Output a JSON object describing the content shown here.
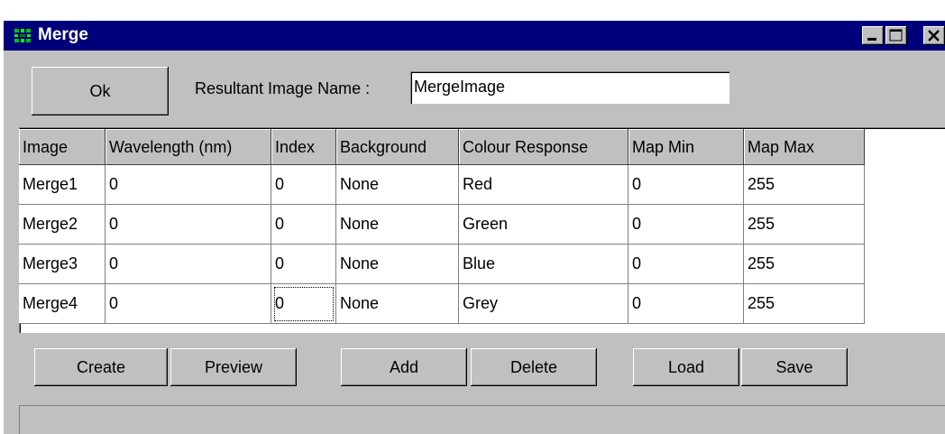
{
  "window": {
    "title": "Merge"
  },
  "toolbar": {
    "ok_label": "Ok"
  },
  "name_field": {
    "label": "Resultant Image Name :",
    "value": "MergeImage"
  },
  "table": {
    "columns": [
      "Image",
      "Wavelength (nm)",
      "Index",
      "Background",
      "Colour Response",
      "Map Min",
      "Map Max"
    ],
    "rows": [
      [
        "Merge1",
        "0",
        "0",
        "None",
        "Red",
        "0",
        "255"
      ],
      [
        "Merge2",
        "0",
        "0",
        "None",
        "Green",
        "0",
        "255"
      ],
      [
        "Merge3",
        "0",
        "0",
        "None",
        "Blue",
        "0",
        "255"
      ],
      [
        "Merge4",
        "0",
        "0",
        "None",
        "Grey",
        "0",
        "255"
      ]
    ]
  },
  "buttons": {
    "create": "Create",
    "preview": "Preview",
    "add": "Add",
    "delete": "Delete",
    "load": "Load",
    "save": "Save"
  },
  "status": {
    "text": ""
  }
}
